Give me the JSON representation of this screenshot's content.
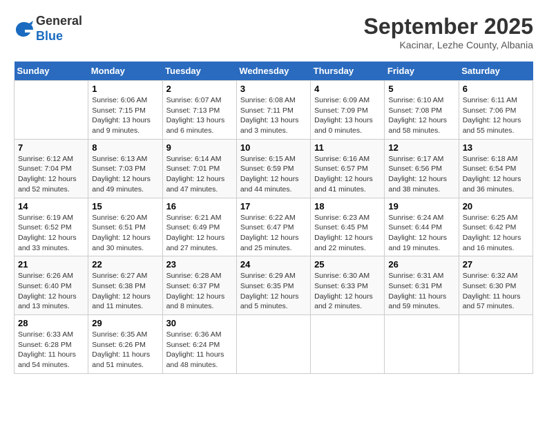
{
  "header": {
    "logo_line1": "General",
    "logo_line2": "Blue",
    "month": "September 2025",
    "location": "Kacinar, Lezhe County, Albania"
  },
  "weekdays": [
    "Sunday",
    "Monday",
    "Tuesday",
    "Wednesday",
    "Thursday",
    "Friday",
    "Saturday"
  ],
  "weeks": [
    [
      {
        "day": "",
        "info": ""
      },
      {
        "day": "1",
        "info": "Sunrise: 6:06 AM\nSunset: 7:15 PM\nDaylight: 13 hours\nand 9 minutes."
      },
      {
        "day": "2",
        "info": "Sunrise: 6:07 AM\nSunset: 7:13 PM\nDaylight: 13 hours\nand 6 minutes."
      },
      {
        "day": "3",
        "info": "Sunrise: 6:08 AM\nSunset: 7:11 PM\nDaylight: 13 hours\nand 3 minutes."
      },
      {
        "day": "4",
        "info": "Sunrise: 6:09 AM\nSunset: 7:09 PM\nDaylight: 13 hours\nand 0 minutes."
      },
      {
        "day": "5",
        "info": "Sunrise: 6:10 AM\nSunset: 7:08 PM\nDaylight: 12 hours\nand 58 minutes."
      },
      {
        "day": "6",
        "info": "Sunrise: 6:11 AM\nSunset: 7:06 PM\nDaylight: 12 hours\nand 55 minutes."
      }
    ],
    [
      {
        "day": "7",
        "info": "Sunrise: 6:12 AM\nSunset: 7:04 PM\nDaylight: 12 hours\nand 52 minutes."
      },
      {
        "day": "8",
        "info": "Sunrise: 6:13 AM\nSunset: 7:03 PM\nDaylight: 12 hours\nand 49 minutes."
      },
      {
        "day": "9",
        "info": "Sunrise: 6:14 AM\nSunset: 7:01 PM\nDaylight: 12 hours\nand 47 minutes."
      },
      {
        "day": "10",
        "info": "Sunrise: 6:15 AM\nSunset: 6:59 PM\nDaylight: 12 hours\nand 44 minutes."
      },
      {
        "day": "11",
        "info": "Sunrise: 6:16 AM\nSunset: 6:57 PM\nDaylight: 12 hours\nand 41 minutes."
      },
      {
        "day": "12",
        "info": "Sunrise: 6:17 AM\nSunset: 6:56 PM\nDaylight: 12 hours\nand 38 minutes."
      },
      {
        "day": "13",
        "info": "Sunrise: 6:18 AM\nSunset: 6:54 PM\nDaylight: 12 hours\nand 36 minutes."
      }
    ],
    [
      {
        "day": "14",
        "info": "Sunrise: 6:19 AM\nSunset: 6:52 PM\nDaylight: 12 hours\nand 33 minutes."
      },
      {
        "day": "15",
        "info": "Sunrise: 6:20 AM\nSunset: 6:51 PM\nDaylight: 12 hours\nand 30 minutes."
      },
      {
        "day": "16",
        "info": "Sunrise: 6:21 AM\nSunset: 6:49 PM\nDaylight: 12 hours\nand 27 minutes."
      },
      {
        "day": "17",
        "info": "Sunrise: 6:22 AM\nSunset: 6:47 PM\nDaylight: 12 hours\nand 25 minutes."
      },
      {
        "day": "18",
        "info": "Sunrise: 6:23 AM\nSunset: 6:45 PM\nDaylight: 12 hours\nand 22 minutes."
      },
      {
        "day": "19",
        "info": "Sunrise: 6:24 AM\nSunset: 6:44 PM\nDaylight: 12 hours\nand 19 minutes."
      },
      {
        "day": "20",
        "info": "Sunrise: 6:25 AM\nSunset: 6:42 PM\nDaylight: 12 hours\nand 16 minutes."
      }
    ],
    [
      {
        "day": "21",
        "info": "Sunrise: 6:26 AM\nSunset: 6:40 PM\nDaylight: 12 hours\nand 13 minutes."
      },
      {
        "day": "22",
        "info": "Sunrise: 6:27 AM\nSunset: 6:38 PM\nDaylight: 12 hours\nand 11 minutes."
      },
      {
        "day": "23",
        "info": "Sunrise: 6:28 AM\nSunset: 6:37 PM\nDaylight: 12 hours\nand 8 minutes."
      },
      {
        "day": "24",
        "info": "Sunrise: 6:29 AM\nSunset: 6:35 PM\nDaylight: 12 hours\nand 5 minutes."
      },
      {
        "day": "25",
        "info": "Sunrise: 6:30 AM\nSunset: 6:33 PM\nDaylight: 12 hours\nand 2 minutes."
      },
      {
        "day": "26",
        "info": "Sunrise: 6:31 AM\nSunset: 6:31 PM\nDaylight: 11 hours\nand 59 minutes."
      },
      {
        "day": "27",
        "info": "Sunrise: 6:32 AM\nSunset: 6:30 PM\nDaylight: 11 hours\nand 57 minutes."
      }
    ],
    [
      {
        "day": "28",
        "info": "Sunrise: 6:33 AM\nSunset: 6:28 PM\nDaylight: 11 hours\nand 54 minutes."
      },
      {
        "day": "29",
        "info": "Sunrise: 6:35 AM\nSunset: 6:26 PM\nDaylight: 11 hours\nand 51 minutes."
      },
      {
        "day": "30",
        "info": "Sunrise: 6:36 AM\nSunset: 6:24 PM\nDaylight: 11 hours\nand 48 minutes."
      },
      {
        "day": "",
        "info": ""
      },
      {
        "day": "",
        "info": ""
      },
      {
        "day": "",
        "info": ""
      },
      {
        "day": "",
        "info": ""
      }
    ]
  ]
}
